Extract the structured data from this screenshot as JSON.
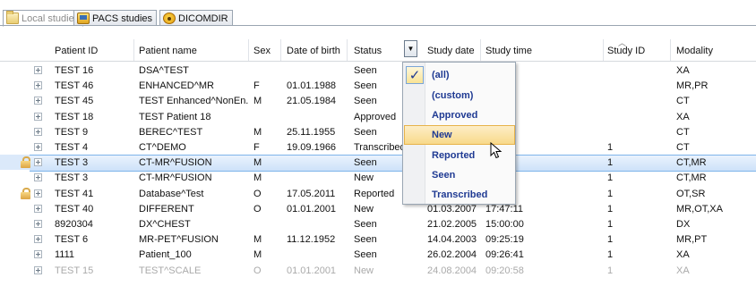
{
  "tabs": [
    {
      "label": "Local studies",
      "icon": "folder-icon",
      "active": true
    },
    {
      "label": "PACS studies",
      "icon": "pacs-icon",
      "active": false
    },
    {
      "label": "DICOMDIR",
      "icon": "dicomdir-icon",
      "active": false
    }
  ],
  "columns": {
    "patient_id": "Patient ID",
    "patient_name": "Patient name",
    "sex": "Sex",
    "dob": "Date of birth",
    "status": "Status",
    "study_date": "Study date",
    "study_time": "Study time",
    "study_id": "Study ID",
    "modality": "Modality"
  },
  "rows": [
    {
      "patient_id": "TEST 16",
      "name": "DSA^TEST",
      "sex": "",
      "dob": "",
      "status": "Seen",
      "study_date": "",
      "study_time": "",
      "study_id": "",
      "modality": "XA"
    },
    {
      "patient_id": "TEST 46",
      "name": "ENHANCED^MR",
      "sex": "F",
      "dob": "01.01.1988",
      "status": "Seen",
      "study_date": "",
      "study_time": "59",
      "study_id": "",
      "modality": "MR,PR"
    },
    {
      "patient_id": "TEST 45",
      "name": "TEST Enhanced^NonEn...",
      "sex": "M",
      "dob": "21.05.1984",
      "status": "Seen",
      "study_date": "",
      "study_time": "47",
      "study_id": "",
      "modality": "CT"
    },
    {
      "patient_id": "TEST 18",
      "name": "TEST Patient 18",
      "sex": "",
      "dob": "",
      "status": "Approved",
      "study_date": "",
      "study_time": "",
      "study_id": "",
      "modality": "XA"
    },
    {
      "patient_id": "TEST 9",
      "name": "BEREC^TEST",
      "sex": "M",
      "dob": "25.11.1955",
      "status": "Seen",
      "study_date": "",
      "study_time": "06",
      "study_id": "",
      "modality": "CT"
    },
    {
      "patient_id": "TEST 4",
      "name": "CT^DEMO",
      "sex": "F",
      "dob": "19.09.1966",
      "status": "Transcribed",
      "study_date": "",
      "study_time": "10",
      "study_id": "1",
      "modality": "CT"
    },
    {
      "patient_id": "TEST 3",
      "name": "CT-MR^FUSION",
      "sex": "M",
      "dob": "",
      "status": "Seen",
      "study_date": "",
      "study_time": "03",
      "study_id": "1",
      "modality": "CT,MR"
    },
    {
      "patient_id": "TEST 3",
      "name": "CT-MR^FUSION",
      "sex": "M",
      "dob": "",
      "status": "New",
      "study_date": "",
      "study_time": "12",
      "study_id": "1",
      "modality": "CT,MR"
    },
    {
      "patient_id": "TEST 41",
      "name": "Database^Test",
      "sex": "O",
      "dob": "17.05.2011",
      "status": "Reported",
      "study_date": "",
      "study_time": ":32",
      "study_id": "1",
      "modality": "OT,SR"
    },
    {
      "patient_id": "TEST 40",
      "name": "DIFFERENT",
      "sex": "O",
      "dob": "01.01.2001",
      "status": "New",
      "study_date": "01.03.2007",
      "study_time": "17:47:11",
      "study_id": "1",
      "modality": "MR,OT,XA"
    },
    {
      "patient_id": "8920304",
      "name": "DX^CHEST",
      "sex": "",
      "dob": "",
      "status": "Seen",
      "study_date": "21.02.2005",
      "study_time": "15:00:00",
      "study_id": "1",
      "modality": "DX"
    },
    {
      "patient_id": "TEST 6",
      "name": "MR-PET^FUSION",
      "sex": "M",
      "dob": "11.12.1952",
      "status": "Seen",
      "study_date": "14.04.2003",
      "study_time": "09:25:19",
      "study_id": "1",
      "modality": "MR,PT"
    },
    {
      "patient_id": "1111",
      "name": "Patient_100",
      "sex": "M",
      "dob": "",
      "status": "Seen",
      "study_date": "26.02.2004",
      "study_time": "09:26:41",
      "study_id": "1",
      "modality": "XA"
    },
    {
      "patient_id": "TEST 15",
      "name": "TEST^SCALE",
      "sex": "O",
      "dob": "01.01.2001",
      "status": "New",
      "study_date": "24.08.2004",
      "study_time": "09:20:58",
      "study_id": "1",
      "modality": "XA"
    }
  ],
  "status_filter": {
    "options": [
      "(all)",
      "(custom)",
      "Approved",
      "New",
      "Reported",
      "Seen",
      "Transcribed"
    ],
    "checked": "(all)",
    "hovered": "New",
    "check_glyph": "✓"
  },
  "sort_glyph": "︿",
  "filter_glyph": "▼",
  "colors": {
    "selection": "#cde2f9",
    "menu_text": "#1f3a93",
    "hover": "#f8d98a"
  }
}
